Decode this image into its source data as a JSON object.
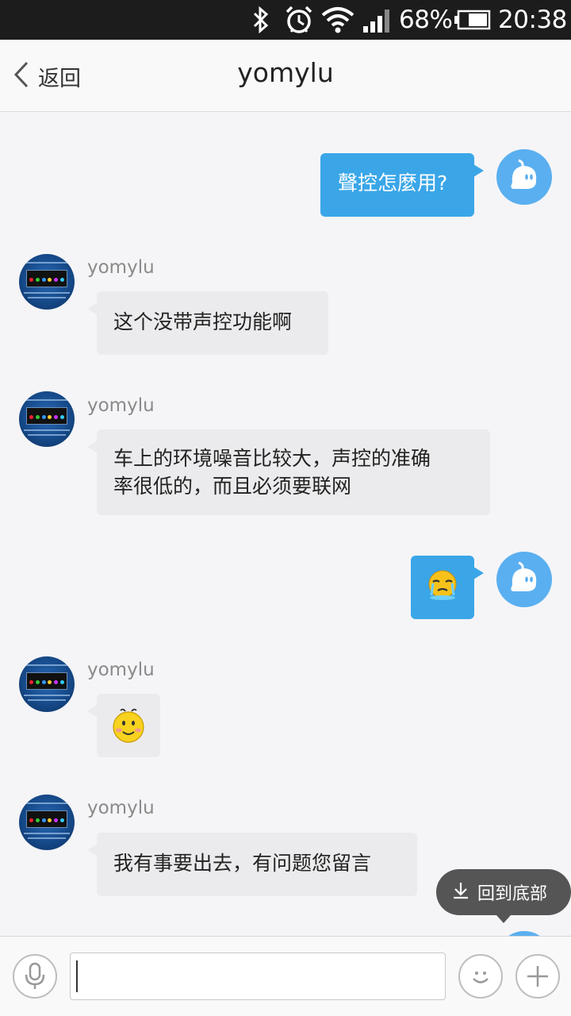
{
  "status_bar": {
    "battery_percent": "68%",
    "time": "20:38"
  },
  "header": {
    "back_label": "返回",
    "title": "yomylu"
  },
  "messages": [
    {
      "from": "me",
      "text": "聲控怎麼用?"
    },
    {
      "from": "other",
      "name": "yomylu",
      "text": "这个没带声控功能啊"
    },
    {
      "from": "other",
      "name": "yomylu",
      "text_line1": "车上的环境噪音比较大，声控的准确",
      "text_line2": "率很低的，而且必须要联网"
    },
    {
      "from": "me",
      "emoji": "crying-emoji"
    },
    {
      "from": "other",
      "name": "yomylu",
      "emoji": "smile-emoji"
    },
    {
      "from": "other",
      "name": "yomylu",
      "text": "我有事要出去，有问题您留言"
    }
  ],
  "back_to_bottom": {
    "label": "回到底部"
  },
  "input_bar": {
    "value": "",
    "placeholder": ""
  },
  "colors": {
    "bubble_me": "#3aa6e8",
    "bubble_other": "#ebebed",
    "avatar_me": "#5aaff0"
  }
}
